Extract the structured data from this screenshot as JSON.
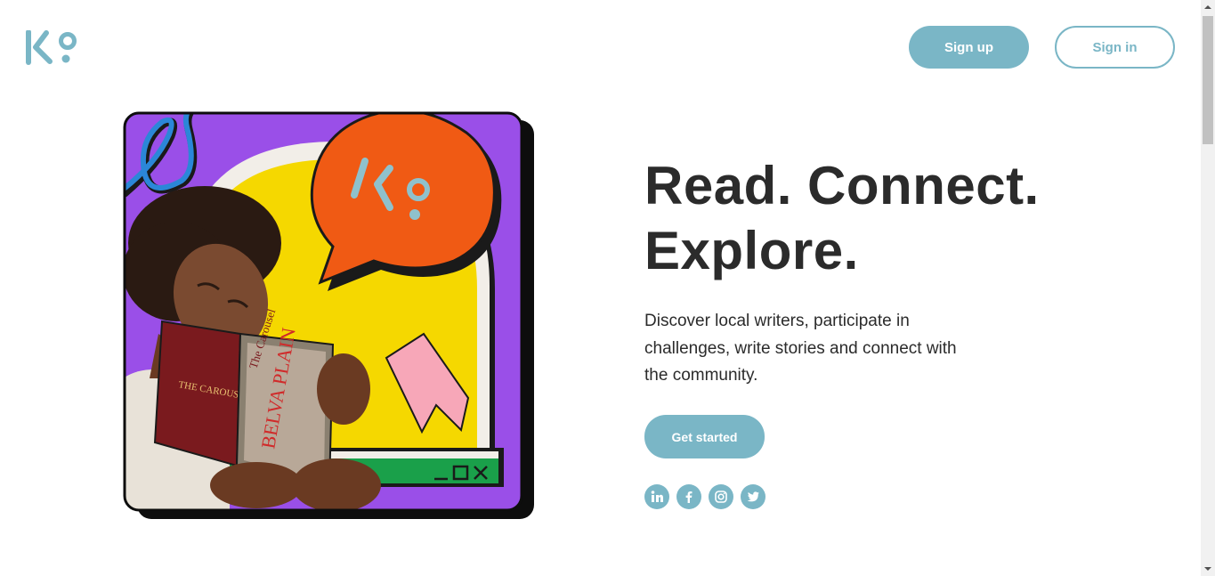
{
  "header": {
    "logo_icon": "ko-logo",
    "signup_label": "Sign up",
    "signin_label": "Sign in"
  },
  "hero": {
    "headline_line1": "Read. Connect.",
    "headline_line2": "Explore.",
    "description": "Discover local writers, participate in challenges, write stories and connect with the community.",
    "cta_label": "Get started",
    "illustration": {
      "speech_bubble_logo": "ko-logo",
      "book_title": "The Carousel",
      "book_author": "Belva Plain",
      "window_controls": [
        "minimize-icon",
        "maximize-icon",
        "close-icon"
      ]
    }
  },
  "socials": [
    {
      "icon": "linkedin-icon",
      "label": "in"
    },
    {
      "icon": "facebook-icon",
      "label": "f"
    },
    {
      "icon": "instagram-icon"
    },
    {
      "icon": "twitter-icon"
    }
  ],
  "colors": {
    "accent": "#7ab6c6",
    "text": "#2b2b2b",
    "purple": "#9a4fe8",
    "yellow": "#f5d800",
    "orange": "#f05a14",
    "pink": "#f7a7b8",
    "green": "#1aa04a"
  }
}
